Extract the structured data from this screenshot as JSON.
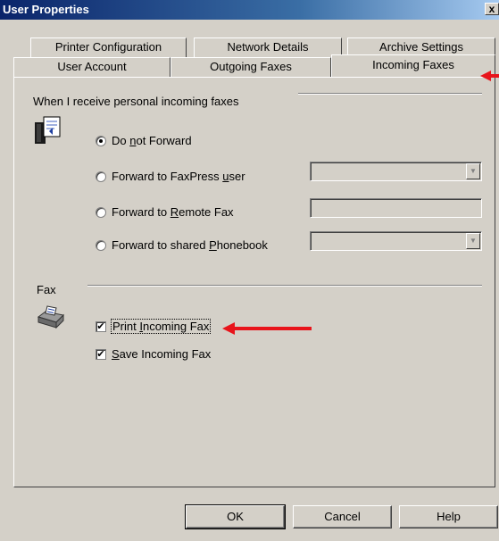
{
  "window": {
    "title": "User Properties",
    "close_glyph": "x"
  },
  "tabs": {
    "row1": [
      {
        "label": "Printer Configuration"
      },
      {
        "label": "Network Details"
      },
      {
        "label": "Archive Settings"
      }
    ],
    "row2": [
      {
        "label": "User Account"
      },
      {
        "label": "Outgoing Faxes"
      },
      {
        "label": "Incoming Faxes",
        "active": true
      }
    ]
  },
  "forward_group": {
    "title": "When I receive personal incoming faxes",
    "icon": "fax-document-icon",
    "options": [
      {
        "pre": "Do ",
        "key": "n",
        "post": "ot Forward",
        "checked": true
      },
      {
        "pre": "Forward to FaxPress ",
        "key": "u",
        "post": "ser",
        "checked": false
      },
      {
        "pre": "Forward to ",
        "key": "R",
        "post": "emote Fax",
        "checked": false
      },
      {
        "pre": "Forward to shared ",
        "key": "P",
        "post": "honebook",
        "checked": false
      }
    ]
  },
  "fax_group": {
    "title": "Fax",
    "icon": "fax-machine-icon",
    "print": {
      "pre": "Print ",
      "key": "I",
      "post": "ncoming Fax",
      "checked": true
    },
    "save": {
      "pre": "",
      "key": "S",
      "post": "ave Incoming Fax",
      "checked": true
    },
    "check_glyph": "✔"
  },
  "buttons": {
    "ok": "OK",
    "cancel": "Cancel",
    "help": "Help"
  },
  "colors": {
    "annotation": "#e8141b",
    "titlebar": "#0a246a",
    "face": "#d4d0c8"
  }
}
